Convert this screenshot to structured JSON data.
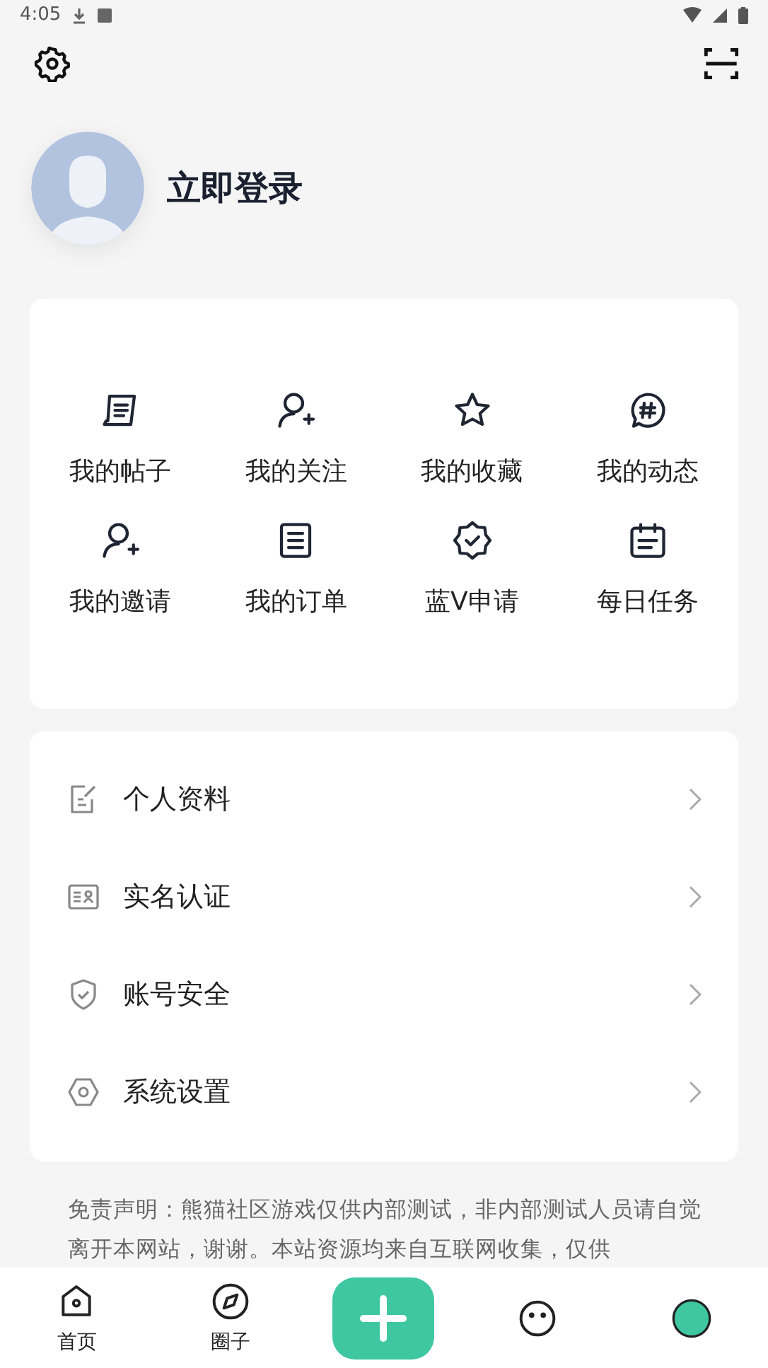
{
  "status_bar": {
    "time": "4:05"
  },
  "profile": {
    "login_label": "立即登录"
  },
  "shortcuts": [
    {
      "kind": "post",
      "label": "我的帖子"
    },
    {
      "kind": "follow",
      "label": "我的关注"
    },
    {
      "kind": "star",
      "label": "我的收藏"
    },
    {
      "kind": "hash",
      "label": "我的动态"
    },
    {
      "kind": "follow",
      "label": "我的邀请"
    },
    {
      "kind": "order",
      "label": "我的订单"
    },
    {
      "kind": "badge",
      "label": "蓝V申请"
    },
    {
      "kind": "calendar",
      "label": "每日任务"
    }
  ],
  "menu": [
    {
      "kind": "edit",
      "label": "个人资料"
    },
    {
      "kind": "idcard",
      "label": "实名认证"
    },
    {
      "kind": "shield",
      "label": "账号安全"
    },
    {
      "kind": "hexagon",
      "label": "系统设置"
    }
  ],
  "disclaimer": "免责声明：熊猫社区游戏仅供内部测试，非内部测试人员请自觉离开本网站，谢谢。本站资源均来自互联网收集，仅供",
  "bottom_nav": [
    {
      "kind": "home",
      "label": "首页"
    },
    {
      "kind": "compass",
      "label": "圈子"
    },
    {
      "kind": "add"
    },
    {
      "kind": "face"
    },
    {
      "kind": "avatar"
    }
  ]
}
